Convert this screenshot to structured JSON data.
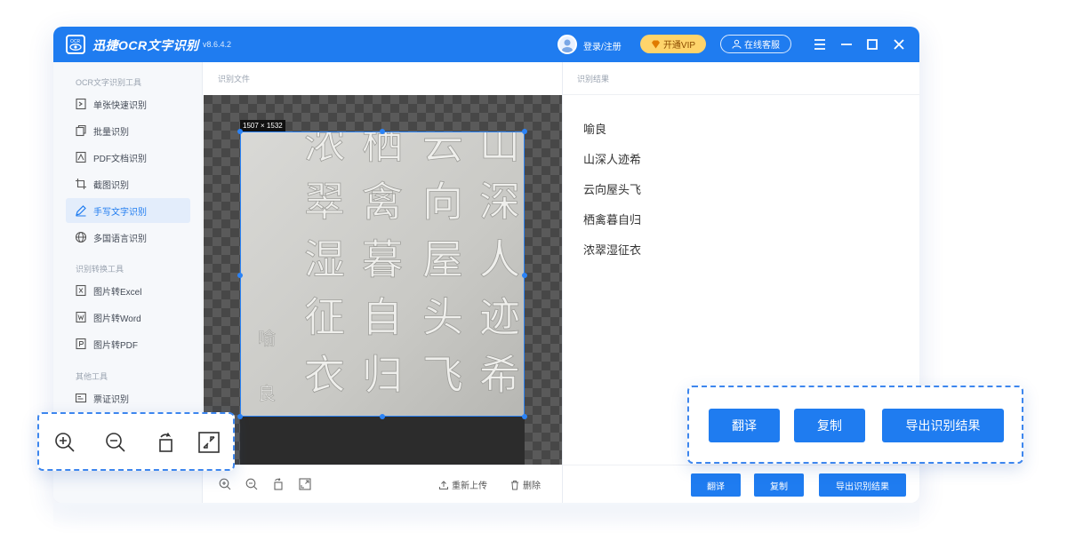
{
  "app": {
    "name": "迅捷OCR文字识别",
    "version": "v8.6.4.2",
    "login_label": "登录/注册",
    "vip_label": "开通VIP",
    "service_label": "在线客服"
  },
  "sidebar": {
    "sections": [
      {
        "title": "OCR文字识别工具",
        "items": [
          "单张快速识别",
          "批量识别",
          "PDF文档识别",
          "截图识别",
          "手写文字识别",
          "多国语言识别"
        ]
      },
      {
        "title": "识别转换工具",
        "items": [
          "图片转Excel",
          "图片转Word",
          "图片转PDF"
        ]
      },
      {
        "title": "其他工具",
        "items": [
          "票证识别"
        ]
      }
    ],
    "active_item": "手写文字识别"
  },
  "file_panel": {
    "title": "识别文件",
    "image_size": "1507 × 1532",
    "reupload_label": "重新上传",
    "delete_label": "删除"
  },
  "result_panel": {
    "title": "识别结果",
    "lines": [
      "喻良",
      "山深人迹希",
      "云向屋头飞",
      "栖禽暮自归",
      "浓翠湿征衣"
    ],
    "translate_label": "翻译",
    "copy_label": "复制",
    "export_label": "导出识别结果"
  },
  "callouts": {
    "translate_label": "翻译",
    "copy_label": "复制",
    "export_label": "导出识别结果"
  },
  "colors": {
    "accent": "#1f7cf0",
    "vip": "#ffd46b",
    "active_bg": "#e3edfb"
  }
}
